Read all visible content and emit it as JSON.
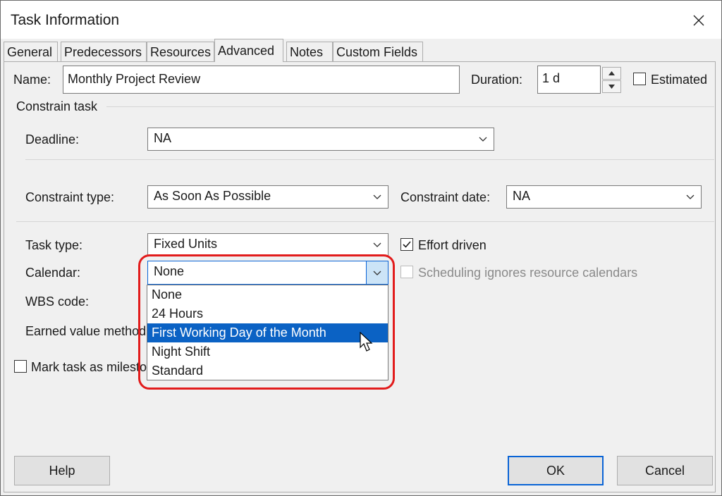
{
  "dialog": {
    "title": "Task Information"
  },
  "tabs": [
    "General",
    "Predecessors",
    "Resources",
    "Advanced",
    "Notes",
    "Custom Fields"
  ],
  "active_tab": "Advanced",
  "fields": {
    "name_label": "Name:",
    "name_value": "Monthly Project Review",
    "duration_label": "Duration:",
    "duration_value": "1 d",
    "estimated_label": "Estimated",
    "estimated_checked": false
  },
  "constrain_task": {
    "group_label": "Constrain task",
    "deadline_label": "Deadline:",
    "deadline_value": "NA",
    "constraint_type_label": "Constraint type:",
    "constraint_type_value": "As Soon As Possible",
    "constraint_date_label": "Constraint date:",
    "constraint_date_value": "NA"
  },
  "task_settings": {
    "task_type_label": "Task type:",
    "task_type_value": "Fixed Units",
    "effort_driven_label": "Effort driven",
    "effort_driven_checked": true,
    "calendar_label": "Calendar:",
    "calendar_value": "None",
    "scheduling_ignores_label": "Scheduling ignores resource calendars",
    "scheduling_ignores_checked": false,
    "wbs_label": "WBS code:",
    "earned_value_label": "Earned value method:",
    "milestone_label": "Mark task as milestone"
  },
  "calendar_dropdown": {
    "options": [
      "None",
      "24 Hours",
      "First Working Day of the Month",
      "Night Shift",
      "Standard"
    ],
    "highlighted": "First Working Day of the Month"
  },
  "buttons": {
    "help": "Help",
    "ok": "OK",
    "cancel": "Cancel"
  },
  "colors": {
    "highlight_ring": "#e21c1c",
    "selection": "#0b62c4",
    "default_button_border": "#0a64d6"
  }
}
